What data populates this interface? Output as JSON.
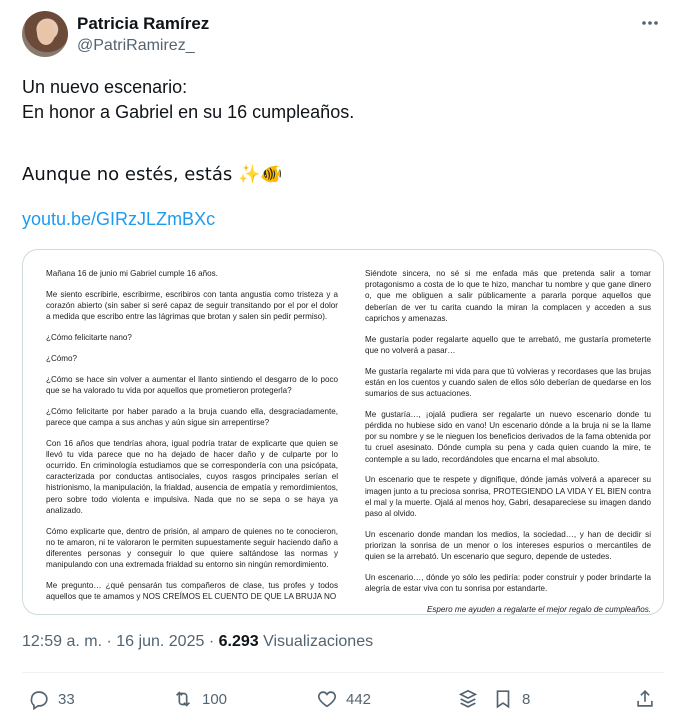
{
  "author": {
    "name": "Patricia Ramírez",
    "handle": "@PatriRamirez_"
  },
  "tweet": {
    "lines": [
      "Un nuevo escenario:",
      "En honor a  Gabriel en su 16 cumpleaños.",
      "",
      "Aunque no estés, estás ✨🐠"
    ],
    "link": "youtu.be/GIRzJLZmBXc"
  },
  "document": {
    "left": [
      "Mañana 16 de junio mi Gabriel cumple 16 años.",
      "Me siento escribirle, escribirme, escribiros con tanta angustia como tristeza y a corazón abierto (sin saber si seré capaz de seguir transitando por el por el dolor a medida que escribo entre las lágrimas que brotan y salen sin pedir permiso).",
      "¿Cómo felicitarte nano?",
      "¿Cómo?",
      "¿Cómo se hace sin volver a aumentar el llanto sintiendo el desgarro de lo poco que se ha valorado tu vida por aquellos que prometieron protegerla?",
      "¿Cómo felicitarte por haber parado a la bruja cuando ella, desgraciadamente, parece que campa a sus anchas y aún sigue sin arrepentirse?",
      "Con 16 años que tendrías ahora, igual podría tratar de explicarte que quien se llevó tu vida parece que no ha dejado de hacer daño y de culparte por lo ocurrido. En criminología estudiamos que se correspondería con una psicópata, caracterizada por conductas antisociales, cuyos rasgos principales serían el histrionismo, la manipulación, la frialdad, ausencia de empatía y remordimientos, pero sobre todo violenta e impulsiva. Nada que no se sepa o se haya ya analizado.",
      "Cómo explicarte que, dentro de prisión, al amparo de quienes no te conocieron, no te amaron, ni te valoraron le permiten supuestamente seguir haciendo daño a diferentes personas y conseguir lo que quiere saltándose las normas y manipulando con una extremada frialdad su entorno sin ningún remordimiento.",
      "Me pregunto… ¿qué pensarán tus compañeros de clase, tus profes y todos aquellos que te amamos y NOS CREÍMOS EL CUENTO DE QUE LA BRUJA NO"
    ],
    "right": [
      "Siéndote sincera, no sé si me enfada más que pretenda salir a tomar protagonismo a costa de lo que te hizo, manchar tu nombre y que gane dinero o, que me obliguen a salir públicamente a pararla porque aquellos que deberían de ver tu carita cuando la miran la complacen y acceden a sus caprichos y amenazas.",
      "Me gustaría poder regalarte aquello que te arrebató, me gustaría prometerte que no volverá a pasar…",
      "Me gustaría regalarte mi vida para que tú volvieras y recordases que las brujas están en los cuentos y cuando salen de ellos sólo deberían de quedarse en los sumarios de sus actuaciones.",
      "Me gustaría…, ¡ojalá pudiera ser regalarte un nuevo escenario donde tu pérdida no hubiese sido en vano! Un escenario dónde a la bruja ni se la llame por su nombre y se le nieguen los beneficios derivados de la fama obtenida por tu cruel asesinato. Dónde cumpla su pena y cada quien cuando la mire, te contemple a su lado, recordándoles que encarna el mal absoluto.",
      "Un escenario que te respete y dignifique, dónde jamás volverá a aparecer su imagen junto a tu preciosa sonrisa, PROTEGIENDO LA VIDA Y EL BIEN contra el mal y la muerte. Ojalá al menos hoy, Gabri, desapareciese su imagen dando paso al olvido.",
      "Un escenario donde mandan los medios, la sociedad…, y han de decidir si priorizan la sonrisa de un menor o los intereses espurios o mercantiles de quien se la arrebató. Un escenario que seguro, depende de ustedes.",
      "Un escenario…, dónde yo sólo les pediría: poder construir y poder brindarte la alegría de estar viva con tu sonrisa por estandarte.",
      "Espero me ayuden a regalarte el mejor regalo de cumpleaños."
    ]
  },
  "meta": {
    "time": "12:59 a. m.",
    "separator": "·",
    "date": "16 jun. 2025",
    "views_count": "6.293",
    "views_label": "Visualizaciones"
  },
  "actions": {
    "replies": "33",
    "reposts": "100",
    "likes": "442",
    "bookmarks": "8"
  },
  "icons": [
    "reply-icon",
    "repost-icon",
    "like-icon",
    "grok-icon",
    "bookmark-icon",
    "share-icon",
    "more-icon"
  ],
  "colors": {
    "link": "#1d9bf0",
    "muted": "#536471",
    "text": "#0f1419",
    "border": "#cfd9de"
  }
}
